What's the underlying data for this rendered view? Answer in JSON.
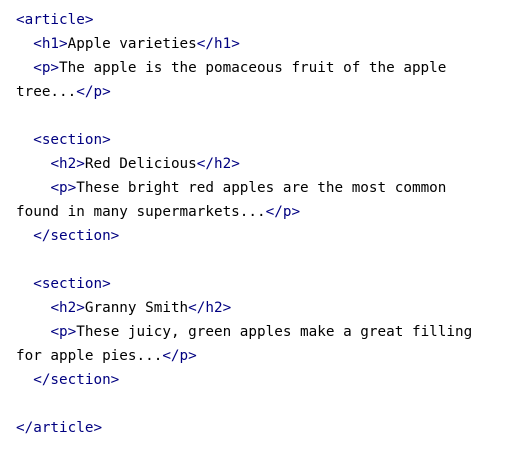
{
  "code_block": {
    "lines": [
      [
        {
          "t": "<article>",
          "k": "tag"
        }
      ],
      [
        {
          "t": "  ",
          "k": "txt"
        },
        {
          "t": "<h1>",
          "k": "tag"
        },
        {
          "t": "Apple varieties",
          "k": "txt"
        },
        {
          "t": "</h1>",
          "k": "tag"
        }
      ],
      [
        {
          "t": "  ",
          "k": "txt"
        },
        {
          "t": "<p>",
          "k": "tag"
        },
        {
          "t": "The apple is the pomaceous fruit of the apple",
          "k": "txt"
        }
      ],
      [
        {
          "t": "tree...",
          "k": "txt"
        },
        {
          "t": "</p>",
          "k": "tag"
        }
      ],
      [],
      [
        {
          "t": "  ",
          "k": "txt"
        },
        {
          "t": "<section>",
          "k": "tag"
        }
      ],
      [
        {
          "t": "    ",
          "k": "txt"
        },
        {
          "t": "<h2>",
          "k": "tag"
        },
        {
          "t": "Red Delicious",
          "k": "txt"
        },
        {
          "t": "</h2>",
          "k": "tag"
        }
      ],
      [
        {
          "t": "    ",
          "k": "txt"
        },
        {
          "t": "<p>",
          "k": "tag"
        },
        {
          "t": "These bright red apples are the most common",
          "k": "txt"
        }
      ],
      [
        {
          "t": "found in many supermarkets...",
          "k": "txt"
        },
        {
          "t": "</p>",
          "k": "tag"
        }
      ],
      [
        {
          "t": "  ",
          "k": "txt"
        },
        {
          "t": "</section>",
          "k": "tag"
        }
      ],
      [],
      [
        {
          "t": "  ",
          "k": "txt"
        },
        {
          "t": "<section>",
          "k": "tag"
        }
      ],
      [
        {
          "t": "    ",
          "k": "txt"
        },
        {
          "t": "<h2>",
          "k": "tag"
        },
        {
          "t": "Granny Smith",
          "k": "txt"
        },
        {
          "t": "</h2>",
          "k": "tag"
        }
      ],
      [
        {
          "t": "    ",
          "k": "txt"
        },
        {
          "t": "<p>",
          "k": "tag"
        },
        {
          "t": "These juicy, green apples make a great filling",
          "k": "txt"
        }
      ],
      [
        {
          "t": "for apple pies...",
          "k": "txt"
        },
        {
          "t": "</p>",
          "k": "tag"
        }
      ],
      [
        {
          "t": "  ",
          "k": "txt"
        },
        {
          "t": "</section>",
          "k": "tag"
        }
      ],
      [],
      [
        {
          "t": "</article>",
          "k": "tag"
        }
      ]
    ],
    "colors": {
      "tag": "#000080",
      "text": "#000000",
      "background": "#ffffff"
    }
  }
}
